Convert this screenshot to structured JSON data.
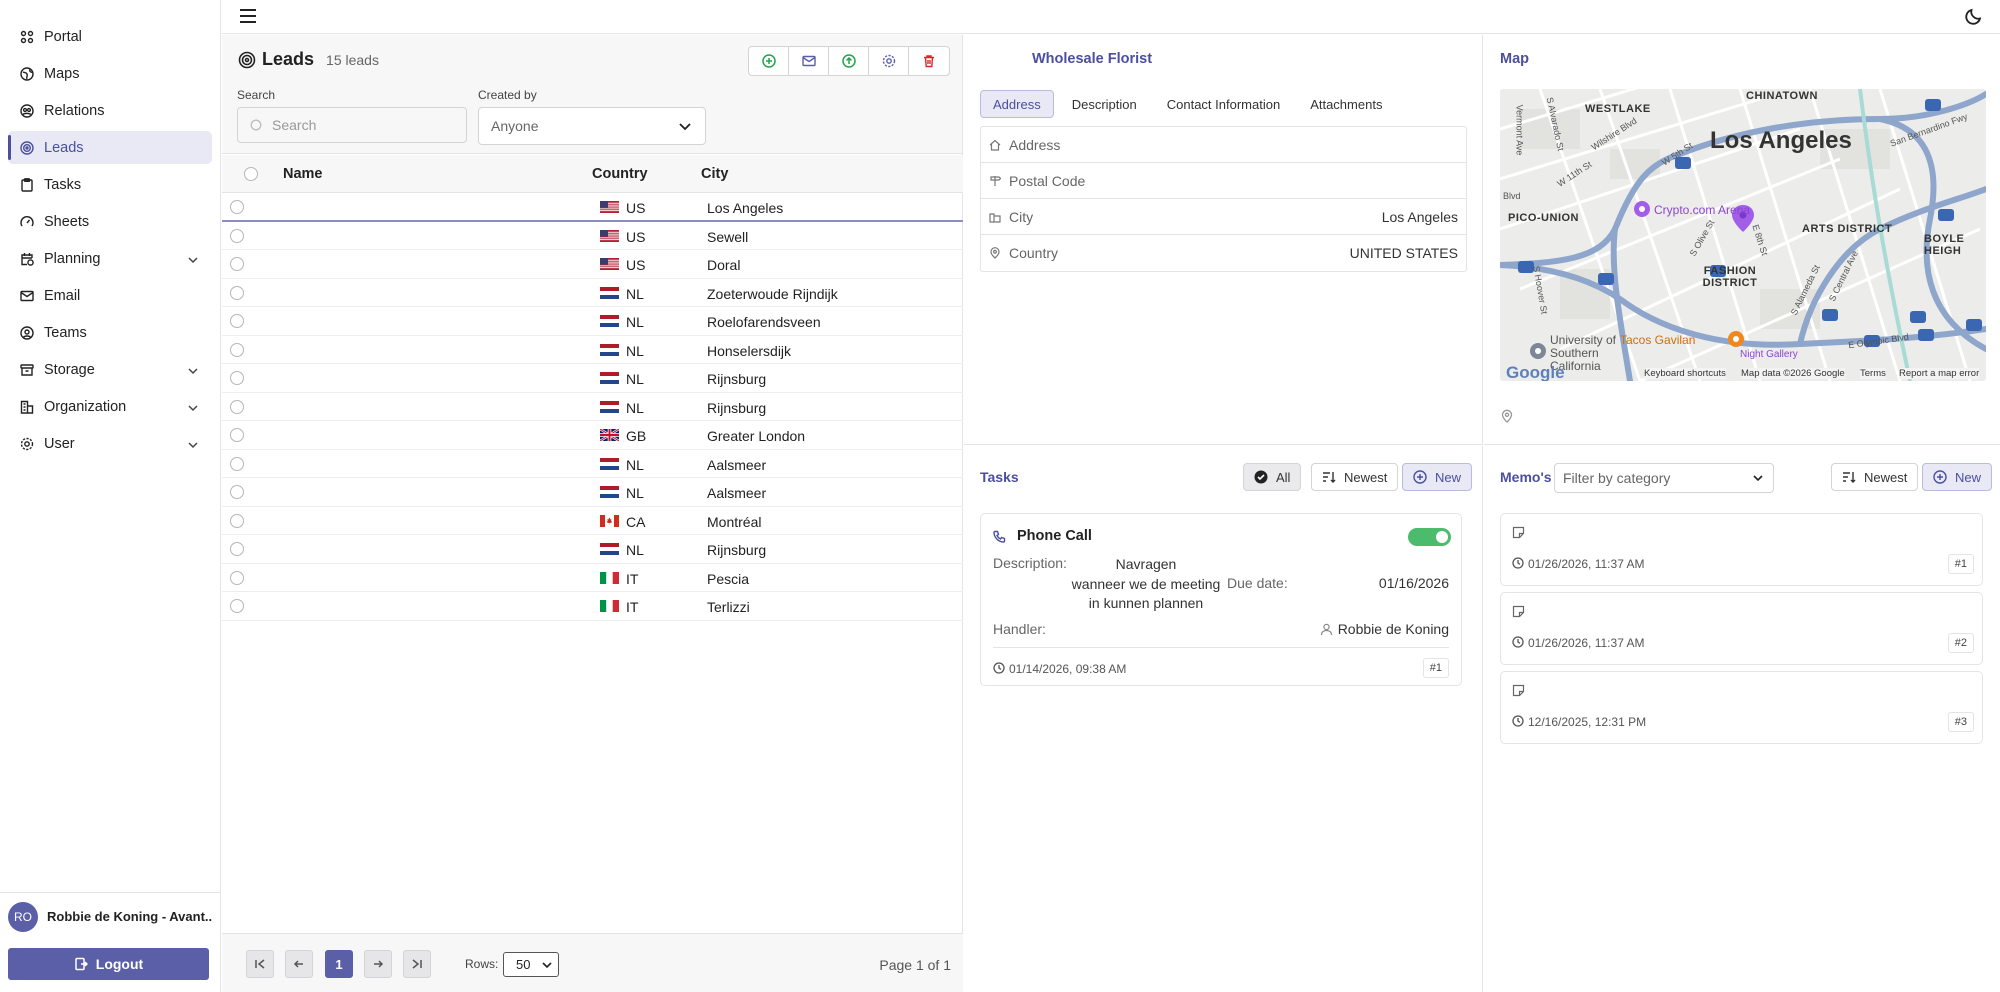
{
  "sidebar": {
    "items": [
      {
        "label": "Portal",
        "icon": "grid-icon"
      },
      {
        "label": "Maps",
        "icon": "globe-icon"
      },
      {
        "label": "Relations",
        "icon": "users-circle-icon"
      },
      {
        "label": "Leads",
        "icon": "target-icon",
        "active": true
      },
      {
        "label": "Tasks",
        "icon": "clipboard-icon"
      },
      {
        "label": "Sheets",
        "icon": "gauge-icon"
      },
      {
        "label": "Planning",
        "icon": "calendar-clock-icon",
        "expandable": true
      },
      {
        "label": "Email",
        "icon": "mail-icon"
      },
      {
        "label": "Teams",
        "icon": "team-icon"
      },
      {
        "label": "Storage",
        "icon": "archive-icon",
        "expandable": true
      },
      {
        "label": "Organization",
        "icon": "building-icon",
        "expandable": true
      },
      {
        "label": "User",
        "icon": "gear-icon",
        "expandable": true
      }
    ],
    "user": {
      "initials": "RO",
      "name": "Robbie de Koning - Avant..."
    },
    "logout_label": "Logout"
  },
  "leads": {
    "title": "Leads",
    "count": "15 leads",
    "search_label": "Search",
    "search_placeholder": "Search",
    "created_by_label": "Created by",
    "created_by_value": "Anyone",
    "columns": {
      "name": "Name",
      "country": "Country",
      "city": "City"
    },
    "rows": [
      {
        "name": "",
        "country": "US",
        "city": "Los Angeles"
      },
      {
        "name": "",
        "country": "US",
        "city": "Sewell"
      },
      {
        "name": "",
        "country": "US",
        "city": "Doral"
      },
      {
        "name": "",
        "country": "NL",
        "city": "Zoeterwoude Rijndijk"
      },
      {
        "name": "",
        "country": "NL",
        "city": "Roelofarendsveen"
      },
      {
        "name": "",
        "country": "NL",
        "city": "Honselersdijk"
      },
      {
        "name": "",
        "country": "NL",
        "city": "Rijnsburg"
      },
      {
        "name": "",
        "country": "NL",
        "city": "Rijnsburg"
      },
      {
        "name": "",
        "country": "GB",
        "city": "Greater London"
      },
      {
        "name": "",
        "country": "NL",
        "city": "Aalsmeer"
      },
      {
        "name": "",
        "country": "NL",
        "city": "Aalsmeer"
      },
      {
        "name": "",
        "country": "CA",
        "city": "Montréal"
      },
      {
        "name": "",
        "country": "NL",
        "city": "Rijnsburg"
      },
      {
        "name": "",
        "country": "IT",
        "city": "Pescia"
      },
      {
        "name": "",
        "country": "IT",
        "city": "Terlizzi"
      }
    ],
    "pager": {
      "current": "1",
      "rows_label": "Rows:",
      "rows_value": "50",
      "page_info": "Page 1 of 1"
    }
  },
  "detail": {
    "title": "Wholesale Florist",
    "tabs": [
      "Address",
      "Description",
      "Contact Information",
      "Attachments"
    ],
    "address": [
      {
        "label": "Address",
        "value": ""
      },
      {
        "label": "Postal Code",
        "value": ""
      },
      {
        "label": "City",
        "value": "Los Angeles"
      },
      {
        "label": "Country",
        "value": "UNITED STATES"
      }
    ]
  },
  "map": {
    "title": "Map",
    "labels": {
      "city": "Los Angeles",
      "chinatown": "CHINATOWN",
      "westlake": "WESTLAKE",
      "pico_union": "PICO-UNION",
      "arts": "ARTS DISTRICT",
      "boyle": "BOYLE HEIGH",
      "fashion": "FASHION DISTRICT",
      "crypto": "Crypto.com Arena",
      "tacos": "Tacos Gavilan",
      "usc": "University of Southern California",
      "wilshire": "Wilshire Blvd",
      "olympic": "E Olympic Blvd",
      "sanbern": "San Bernardino Fwy",
      "w5": "W 5th St",
      "w11": "W 11th St",
      "olive": "S Olive St",
      "hoover": "S Hoover St",
      "alameda": "S Alameda St",
      "central": "S Central Ave",
      "e8": "E 8th St",
      "vermont": "Vermont Ave",
      "alvarado": "S Alvarado St",
      "blvd": "Blvd",
      "night": "Night Gallery"
    },
    "attribution": {
      "logo": "Google",
      "shortcuts": "Keyboard shortcuts",
      "data": "Map data ©2026 Google",
      "terms": "Terms",
      "report": "Report a map error"
    }
  },
  "tasks": {
    "title": "Tasks",
    "filter_all": "All",
    "sort_label": "Newest",
    "new_label": "New",
    "card": {
      "title": "Phone Call",
      "description_label": "Description:",
      "description_lines": [
        "Navragen",
        "wanneer we de meeting",
        "in kunnen plannen"
      ],
      "due_label": "Due date:",
      "due_value": "01/16/2026",
      "handler_label": "Handler:",
      "handler_value": "Robbie de Koning",
      "timestamp": "01/14/2026, 09:38 AM",
      "number": "#1"
    }
  },
  "memos": {
    "title": "Memo's",
    "filter_placeholder": "Filter by category",
    "sort_label": "Newest",
    "new_label": "New",
    "items": [
      {
        "timestamp": "01/26/2026, 11:37 AM",
        "number": "#1"
      },
      {
        "timestamp": "01/26/2026, 11:37 AM",
        "number": "#2"
      },
      {
        "timestamp": "12/16/2025, 12:31 PM",
        "number": "#3"
      }
    ]
  },
  "colors": {
    "accent": "#5b5fa8",
    "accent_text": "#4b4f9e",
    "toggle_on": "#4cbb6c",
    "map_road": "#8ea6cc",
    "map_marker": "#a25ee8"
  }
}
